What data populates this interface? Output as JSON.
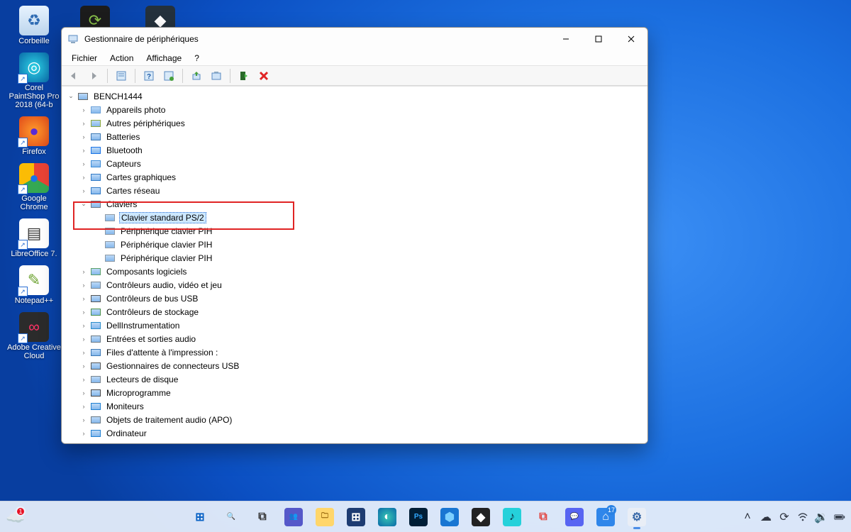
{
  "desktop": {
    "items": [
      {
        "label": "Corbeille",
        "icon": "recycle-bin-icon",
        "bg": "linear-gradient(#e7f3ff,#bcd5ed)",
        "glyph": "♻",
        "glyphColor": "#2e6bb3",
        "shortcut": false
      },
      {
        "label": "",
        "icon": "jdownloader-icon",
        "bg": "#1c1c1c",
        "glyph": "⟳",
        "glyphColor": "#8ac24a",
        "shortcut": true
      },
      {
        "label": "",
        "icon": "app-dark-icon",
        "bg": "#24313c",
        "glyph": "◆",
        "glyphColor": "#fff",
        "shortcut": true
      },
      {
        "label": "Corel PaintShop Pro 2018 (64-b",
        "icon": "paintshop-icon",
        "bg": "radial-gradient(#2dd3e6,#0a6aa8)",
        "glyph": "◎",
        "glyphColor": "#fff",
        "shortcut": true
      },
      {
        "label": "Firefox",
        "icon": "firefox-icon",
        "bg": "radial-gradient(#ff9b2b,#e04a1a)",
        "glyph": "●",
        "glyphColor": "#5a2bd4",
        "shortcut": true
      },
      {
        "label": "Google Chrome",
        "icon": "chrome-icon",
        "bg": "conic-gradient(#ea4335 0 120deg,#34a853 120deg 240deg,#fbbc05 240deg 360deg)",
        "glyph": "●",
        "glyphColor": "#1a73e8",
        "shortcut": true
      },
      {
        "label": "LibreOffice 7.",
        "icon": "libreoffice-icon",
        "bg": "#ffffff",
        "glyph": "▤",
        "glyphColor": "#333",
        "shortcut": true
      },
      {
        "label": "Notepad++",
        "icon": "notepadpp-icon",
        "bg": "#ffffff",
        "glyph": "✎",
        "glyphColor": "#6aa12d",
        "shortcut": true
      },
      {
        "label": "Adobe Creative Cloud",
        "icon": "adobe-cc-icon",
        "bg": "#2b2b2b",
        "glyph": "∞",
        "glyphColor": "#ff3366",
        "shortcut": true
      }
    ]
  },
  "window": {
    "title": "Gestionnaire de périphériques",
    "menu": [
      "Fichier",
      "Action",
      "Affichage",
      "?"
    ],
    "toolbar": [
      "back",
      "forward",
      "sep",
      "props",
      "sep",
      "help",
      "sep",
      "scan",
      "sep",
      "update",
      "uninstall",
      "sep",
      "enable",
      "disable"
    ]
  },
  "tree": {
    "root": {
      "label": "BENCH1444",
      "expanded": true
    },
    "items": [
      {
        "label": "Appareils photo",
        "iconColor": "#6aa0d8"
      },
      {
        "label": "Autres périphériques",
        "iconColor": "#8aa83a"
      },
      {
        "label": "Batteries",
        "iconColor": "#3c78b4"
      },
      {
        "label": "Bluetooth",
        "iconColor": "#1a74e8"
      },
      {
        "label": "Capteurs",
        "iconColor": "#3a8bd8"
      },
      {
        "label": "Cartes graphiques",
        "iconColor": "#2f79c6"
      },
      {
        "label": "Cartes réseau",
        "iconColor": "#2f79c6"
      },
      {
        "label": "Claviers",
        "expanded": true,
        "iconColor": "#6c7a88",
        "children": [
          {
            "label": "Clavier standard PS/2",
            "selected": true
          },
          {
            "label": "Périphérique clavier PIH"
          },
          {
            "label": "Périphérique clavier PIH"
          },
          {
            "label": "Périphérique clavier PIH"
          }
        ]
      },
      {
        "label": "Composants logiciels",
        "iconColor": "#5aa06a"
      },
      {
        "label": "Contrôleurs audio, vidéo et jeu",
        "iconColor": "#7b8994"
      },
      {
        "label": "Contrôleurs de bus USB",
        "iconColor": "#555"
      },
      {
        "label": "Contrôleurs de stockage",
        "iconColor": "#4a8f4a"
      },
      {
        "label": "DellInstrumentation",
        "iconColor": "#2a8cc9"
      },
      {
        "label": "Entrées et sorties audio",
        "iconColor": "#6a7a86"
      },
      {
        "label": "Files d'attente à l'impression :",
        "iconColor": "#3c78b4"
      },
      {
        "label": "Gestionnaires de connecteurs USB",
        "iconColor": "#555"
      },
      {
        "label": "Lecteurs de disque",
        "iconColor": "#7a858f"
      },
      {
        "label": "Microprogramme",
        "iconColor": "#444"
      },
      {
        "label": "Moniteurs",
        "iconColor": "#1e7fd1"
      },
      {
        "label": "Objets de traitement audio (APO)",
        "iconColor": "#6a7a86"
      },
      {
        "label": "Ordinateur",
        "iconColor": "#1e7fd1",
        "cut": true
      }
    ]
  },
  "taskbar": {
    "weatherBadge": "1",
    "items": [
      {
        "name": "start",
        "bg": "transparent",
        "glyph": "⊞",
        "col": "#0b63c5"
      },
      {
        "name": "search",
        "bg": "transparent",
        "glyph": "🔍",
        "col": "#222"
      },
      {
        "name": "taskview",
        "bg": "transparent",
        "glyph": "⧉",
        "col": "#333"
      },
      {
        "name": "teams",
        "bg": "#5558c9",
        "glyph": "👥",
        "col": "#fff"
      },
      {
        "name": "explorer",
        "bg": "#ffd66b",
        "glyph": "🗀",
        "col": "#8a5a00"
      },
      {
        "name": "store",
        "bg": "#1e3c72",
        "glyph": "⊞",
        "col": "#fff"
      },
      {
        "name": "edge",
        "bg": "radial-gradient(#36c5b4,#0b6aa8)",
        "glyph": "◐",
        "col": "#fff"
      },
      {
        "name": "photoshop",
        "bg": "#001e36",
        "glyph": "Ps",
        "col": "#31a8ff"
      },
      {
        "name": "app-hex",
        "bg": "#1976d2",
        "glyph": "⬢",
        "col": "#7dd0ff"
      },
      {
        "name": "app-cube",
        "bg": "#222",
        "glyph": "◆",
        "col": "#fff"
      },
      {
        "name": "amazon-music",
        "bg": "#25d1da",
        "glyph": "♪",
        "col": "#0a2b3a",
        "label": "amazon music"
      },
      {
        "name": "snip",
        "bg": "transparent",
        "glyph": "⧉",
        "col": "#e2443f"
      },
      {
        "name": "discord",
        "bg": "#5865f2",
        "glyph": "💬",
        "col": "#fff"
      },
      {
        "name": "app-blue",
        "bg": "#2f86ea",
        "glyph": "⌂",
        "col": "#fff",
        "badge": "17"
      },
      {
        "name": "device-manager",
        "bg": "#e9eef6",
        "glyph": "⚙",
        "col": "#3a6aa9",
        "active": true
      }
    ],
    "tray": {
      "lang": ""
    }
  }
}
